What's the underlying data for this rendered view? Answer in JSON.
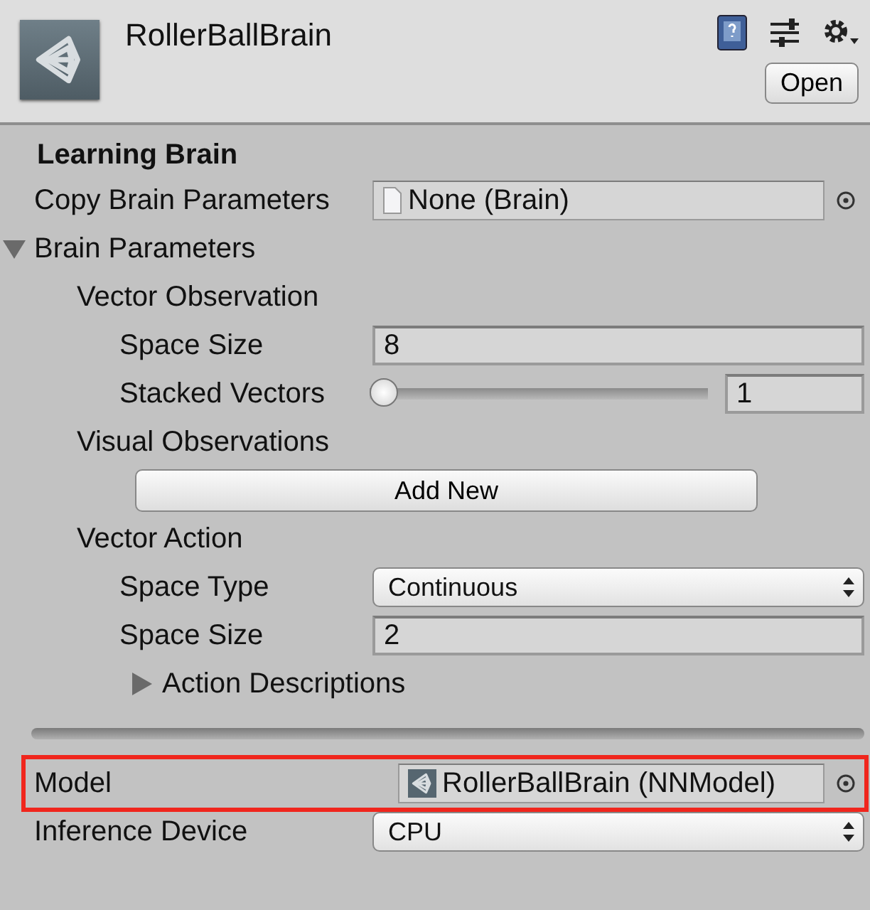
{
  "header": {
    "title": "RollerBallBrain",
    "open_button": "Open"
  },
  "section_title": "Learning Brain",
  "fields": [
    {
      "kind": "object",
      "label": "Copy Brain Parameters",
      "value": "None (Brain)",
      "empty": true,
      "highlighted": false
    },
    {
      "kind": "foldout",
      "label": "Brain Parameters",
      "expanded": true,
      "children": [
        {
          "kind": "group",
          "label": "Vector Observation",
          "children": [
            {
              "kind": "int",
              "label": "Space Size",
              "value": "8"
            },
            {
              "kind": "slider",
              "label": "Stacked Vectors",
              "level": 0,
              "value": "1"
            }
          ]
        },
        {
          "kind": "group",
          "label": "Visual Observations",
          "children": [
            {
              "kind": "button",
              "label": "Add New"
            }
          ]
        },
        {
          "kind": "group",
          "label": "Vector Action",
          "children": [
            {
              "kind": "dropdown",
              "label": "Space Type",
              "value": "Continuous"
            },
            {
              "kind": "int",
              "label": "Space Size",
              "value": "2"
            },
            {
              "kind": "foldout",
              "label": "Action Descriptions",
              "expanded": false
            }
          ]
        }
      ]
    }
  ],
  "model_fields": [
    {
      "kind": "object",
      "label": "Model",
      "value": "RollerBallBrain (NNModel)",
      "empty": false,
      "highlighted": true
    },
    {
      "kind": "dropdown",
      "label": "Inference Device",
      "value": "CPU"
    }
  ]
}
